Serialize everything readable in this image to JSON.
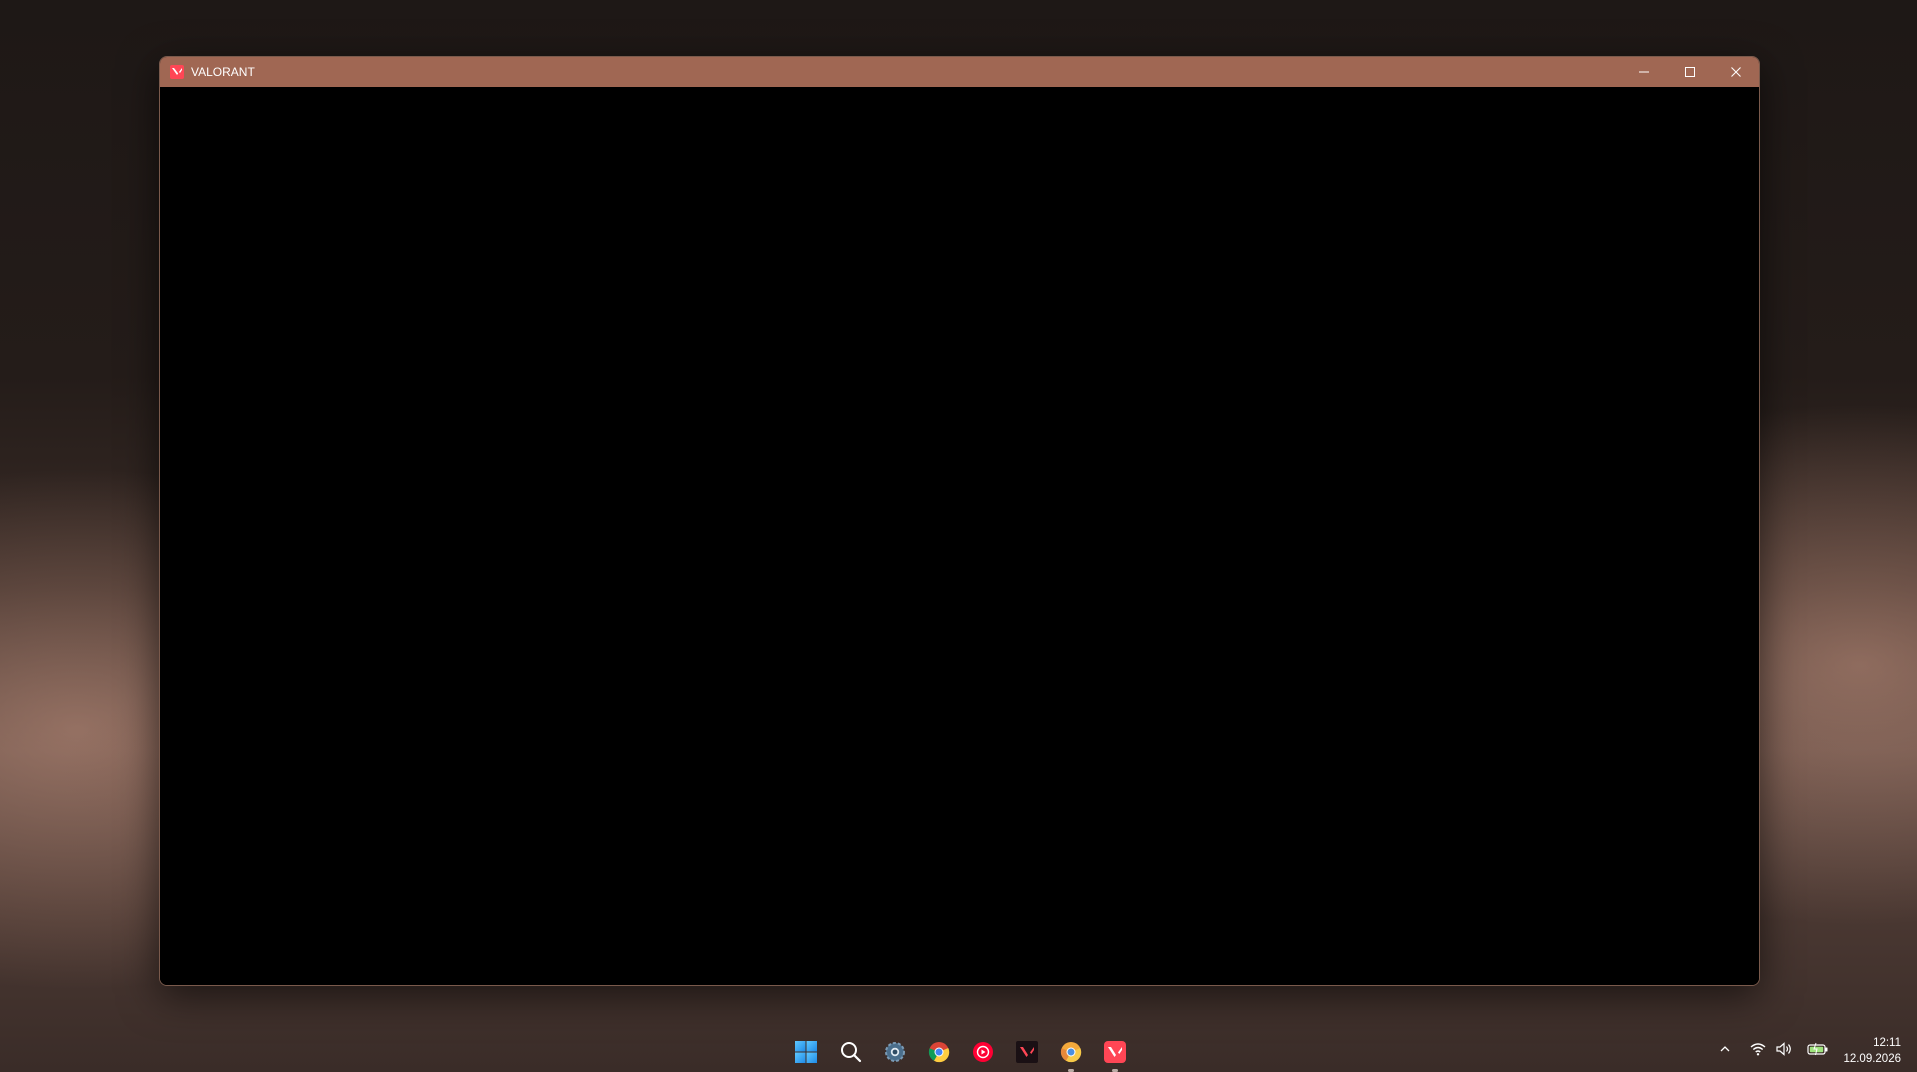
{
  "window": {
    "title": "VALORANT",
    "titlebar_color": "#a06753",
    "content_color": "#000000",
    "controls": {
      "minimize_icon": "minimize-icon",
      "maximize_icon": "maximize-icon",
      "close_icon": "close-icon"
    }
  },
  "taskbar": {
    "apps": [
      {
        "name": "start",
        "icon": "windows-logo-icon"
      },
      {
        "name": "search",
        "icon": "search-icon"
      },
      {
        "name": "settings",
        "icon": "gear-icon"
      },
      {
        "name": "chrome",
        "icon": "chrome-icon"
      },
      {
        "name": "youtube-music",
        "icon": "youtube-music-icon"
      },
      {
        "name": "valorant-dark",
        "icon": "valorant-icon"
      },
      {
        "name": "chrome-canary",
        "icon": "chrome-canary-icon",
        "running": true
      },
      {
        "name": "valorant",
        "icon": "valorant-icon",
        "running": true
      }
    ]
  },
  "tray": {
    "icons": [
      "chevron-up-icon",
      "wifi-icon",
      "volume-icon",
      "battery-icon"
    ],
    "time": "12:11",
    "date": "12.09.2026"
  },
  "colors": {
    "accent_red": "#ff4655",
    "titlebar": "#a06753"
  }
}
